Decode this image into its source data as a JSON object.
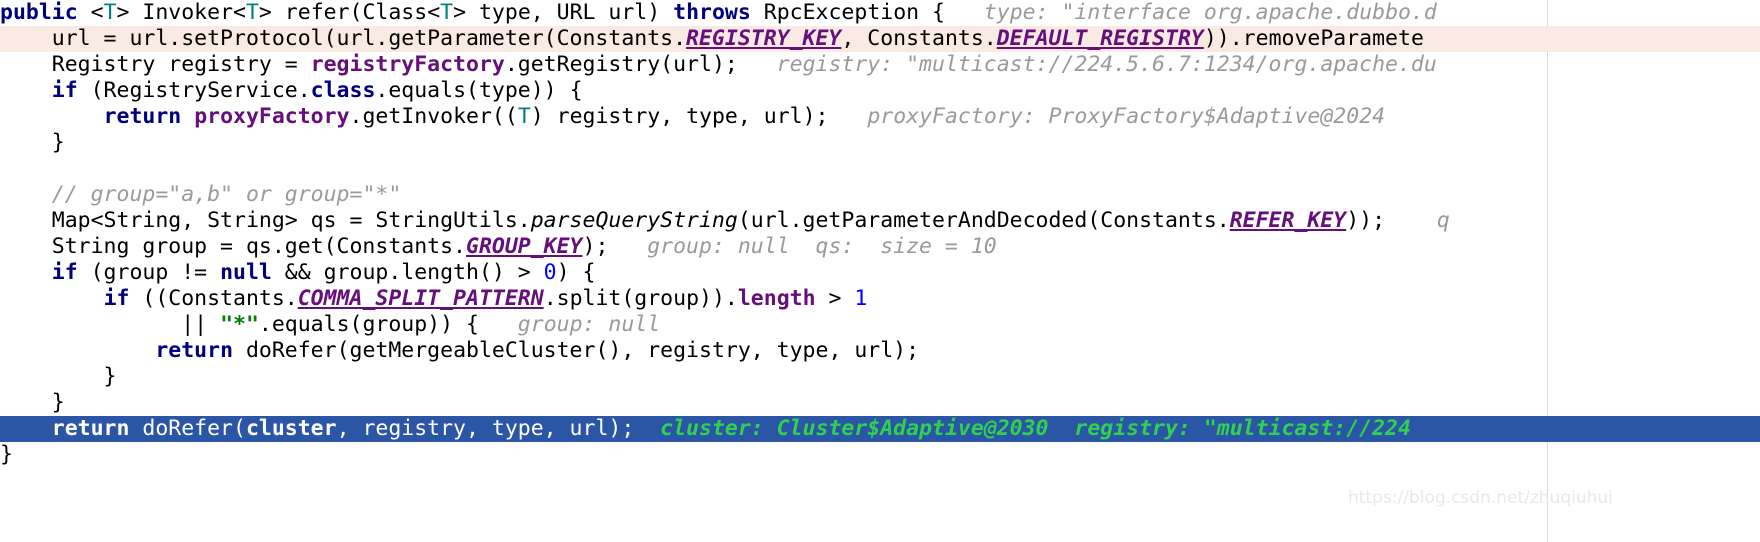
{
  "editor": {
    "language": "java",
    "margin_guide_x": 1547,
    "colors": {
      "background": "#ffffff",
      "executing_line_background": "#2b55a5",
      "modified_line_background": "#faeae4",
      "keyword": "#000080",
      "constant_field": "#660e7a",
      "string": "#008000",
      "number": "#0000ff",
      "type_parameter": "#008080",
      "inline_hint": "#9a9a9a",
      "inline_hint_on_selection": "#2fd14f",
      "margin_guide": "#d8d8d8"
    }
  },
  "watermark": {
    "text": "https://blog.csdn.net/zhuqiuhui"
  },
  "code_lines": [
    {
      "id": "line-1",
      "highlight": "none",
      "tokens": [
        {
          "style": "kw",
          "text": "public"
        },
        {
          "style": "plain",
          "text": " <"
        },
        {
          "style": "type",
          "text": "T"
        },
        {
          "style": "plain",
          "text": "> Invoker<"
        },
        {
          "style": "type",
          "text": "T"
        },
        {
          "style": "plain",
          "text": "> refer(Class<"
        },
        {
          "style": "type",
          "text": "T"
        },
        {
          "style": "plain",
          "text": "> type, URL url) "
        },
        {
          "style": "kw",
          "text": "throws"
        },
        {
          "style": "plain",
          "text": " RpcException {"
        },
        {
          "style": "hint",
          "text": "   type: \"interface org.apache.dubbo.d"
        }
      ]
    },
    {
      "id": "line-2",
      "highlight": "pink",
      "tokens": [
        {
          "style": "plain",
          "text": "    url = url.setProtocol(url.getParameter(Constants."
        },
        {
          "style": "const",
          "text": "REGISTRY_KEY"
        },
        {
          "style": "plain",
          "text": ", Constants."
        },
        {
          "style": "const",
          "text": "DEFAULT_REGISTRY"
        },
        {
          "style": "plain",
          "text": ")).removeParamete"
        }
      ]
    },
    {
      "id": "line-3",
      "highlight": "none",
      "tokens": [
        {
          "style": "plain",
          "text": "    Registry registry = "
        },
        {
          "style": "field",
          "text": "registryFactory"
        },
        {
          "style": "plain",
          "text": ".getRegistry(url);"
        },
        {
          "style": "hint",
          "text": "   registry: \"multicast://224.5.6.7:1234/org.apache.du"
        }
      ]
    },
    {
      "id": "line-4",
      "highlight": "none",
      "tokens": [
        {
          "style": "plain",
          "text": "    "
        },
        {
          "style": "kw",
          "text": "if"
        },
        {
          "style": "plain",
          "text": " (RegistryService."
        },
        {
          "style": "kw",
          "text": "class"
        },
        {
          "style": "plain",
          "text": ".equals(type)) {"
        }
      ]
    },
    {
      "id": "line-5",
      "highlight": "none",
      "tokens": [
        {
          "style": "plain",
          "text": "        "
        },
        {
          "style": "kw",
          "text": "return"
        },
        {
          "style": "plain",
          "text": " "
        },
        {
          "style": "field",
          "text": "proxyFactory"
        },
        {
          "style": "plain",
          "text": ".getInvoker(("
        },
        {
          "style": "type",
          "text": "T"
        },
        {
          "style": "plain",
          "text": ") registry, type, url);"
        },
        {
          "style": "hint",
          "text": "   proxyFactory: ProxyFactory$Adaptive@2024"
        }
      ]
    },
    {
      "id": "line-6",
      "highlight": "none",
      "tokens": [
        {
          "style": "plain",
          "text": "    }"
        }
      ]
    },
    {
      "id": "line-7",
      "highlight": "none",
      "tokens": [
        {
          "style": "plain",
          "text": ""
        }
      ]
    },
    {
      "id": "line-8",
      "highlight": "none",
      "tokens": [
        {
          "style": "plain",
          "text": "    "
        },
        {
          "style": "comment",
          "text": "// group=\"a,b\" or group=\"*\""
        }
      ]
    },
    {
      "id": "line-9",
      "highlight": "none",
      "tokens": [
        {
          "style": "plain",
          "text": "    Map<String, String> qs = StringUtils."
        },
        {
          "style": "method",
          "text": "parseQueryString"
        },
        {
          "style": "plain",
          "text": "(url.getParameterAndDecoded(Constants."
        },
        {
          "style": "const",
          "text": "REFER_KEY"
        },
        {
          "style": "plain",
          "text": "));"
        },
        {
          "style": "hint",
          "text": "    q"
        }
      ]
    },
    {
      "id": "line-10",
      "highlight": "none",
      "tokens": [
        {
          "style": "plain",
          "text": "    String group = qs.get(Constants."
        },
        {
          "style": "const",
          "text": "GROUP_KEY"
        },
        {
          "style": "plain",
          "text": ");"
        },
        {
          "style": "hint",
          "text": "   group: null  qs:  size = 10"
        }
      ]
    },
    {
      "id": "line-11",
      "highlight": "none",
      "tokens": [
        {
          "style": "plain",
          "text": "    "
        },
        {
          "style": "kw",
          "text": "if"
        },
        {
          "style": "plain",
          "text": " (group != "
        },
        {
          "style": "kw",
          "text": "null"
        },
        {
          "style": "plain",
          "text": " && group.length() > "
        },
        {
          "style": "num",
          "text": "0"
        },
        {
          "style": "plain",
          "text": ") {"
        }
      ]
    },
    {
      "id": "line-12",
      "highlight": "none",
      "tokens": [
        {
          "style": "plain",
          "text": "        "
        },
        {
          "style": "kw",
          "text": "if"
        },
        {
          "style": "plain",
          "text": " ((Constants."
        },
        {
          "style": "const",
          "text": "COMMA_SPLIT_PATTERN"
        },
        {
          "style": "plain",
          "text": ".split(group))."
        },
        {
          "style": "field",
          "text": "length"
        },
        {
          "style": "plain",
          "text": " > "
        },
        {
          "style": "num",
          "text": "1"
        }
      ]
    },
    {
      "id": "line-13",
      "highlight": "none",
      "tokens": [
        {
          "style": "plain",
          "text": "              || "
        },
        {
          "style": "str",
          "text": "\"*\""
        },
        {
          "style": "plain",
          "text": ".equals(group)) {"
        },
        {
          "style": "hint",
          "text": "   group: null"
        }
      ]
    },
    {
      "id": "line-14",
      "highlight": "none",
      "tokens": [
        {
          "style": "plain",
          "text": "            "
        },
        {
          "style": "kw",
          "text": "return"
        },
        {
          "style": "plain",
          "text": " doRefer(getMergeableCluster(), registry, type, url);"
        }
      ]
    },
    {
      "id": "line-15",
      "highlight": "none",
      "tokens": [
        {
          "style": "plain",
          "text": "        }"
        }
      ]
    },
    {
      "id": "line-16",
      "highlight": "none",
      "tokens": [
        {
          "style": "plain",
          "text": "    }"
        }
      ]
    },
    {
      "id": "line-17",
      "highlight": "blue",
      "tokens": [
        {
          "style": "plain",
          "text": "    "
        },
        {
          "style": "kw",
          "text": "return"
        },
        {
          "style": "plain",
          "text": " doRefer("
        },
        {
          "style": "field",
          "text": "cluster"
        },
        {
          "style": "plain",
          "text": ", registry, type, url);"
        },
        {
          "style": "hint",
          "text": "  cluster: Cluster$Adaptive@2030  registry: \"multicast://224"
        }
      ]
    },
    {
      "id": "line-18",
      "highlight": "none",
      "tokens": [
        {
          "style": "plain",
          "text": "}"
        }
      ]
    }
  ]
}
